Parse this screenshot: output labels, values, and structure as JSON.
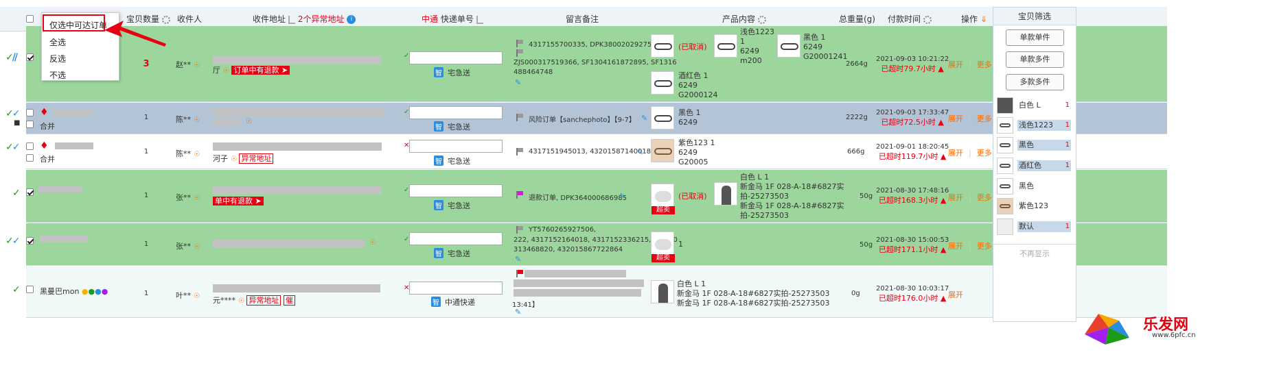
{
  "header": {
    "col_qty": "宝贝数量",
    "col_receiver": "收件人",
    "col_address": "收件地址",
    "col_abnormal": "2个异常地址",
    "col_express": "中通",
    "col_tracking": "快递单号",
    "col_remark": "留言备注",
    "col_product": "产品内容",
    "col_weight": "总重量(g)",
    "col_paytime": "付款时间",
    "col_action": "操作",
    "col_filter": "宝贝筛选"
  },
  "popup": {
    "items": [
      "仅选中可达订单",
      "全选",
      "反选",
      "不选"
    ]
  },
  "rows": [
    {
      "qty": "3",
      "receiver": "赵**",
      "addr_prefix": "厅",
      "addr_badge": "订单中有退款",
      "express_label": "宅急送",
      "remark_lines": [
        "4317155700335, DPK380020292752",
        "ZJS000317519366, SF1304161872895, SF1316",
        "488464748"
      ],
      "products": [
        {
          "status": "(已取消)",
          "lines": []
        },
        {
          "lines": [
            "浅色1223",
            "1",
            "6249",
            "m200"
          ]
        },
        {
          "lines": [
            "黑色 1",
            "6249",
            "G20001241"
          ]
        },
        {
          "lines": [
            "酒红色 1",
            "6249",
            "G2000124"
          ]
        }
      ],
      "weight": "2664g",
      "paytime": "2021-09-03 10:21:22",
      "timeout": "已超时79.7小时",
      "open": "展开",
      "more": "更多"
    },
    {
      "tag": "合并",
      "qty": "1",
      "receiver": "陈**",
      "express_label": "宅急送",
      "remark_lines": [
        "风险订单【sanchephoto】【9-7】"
      ],
      "products": [
        {
          "lines": [
            "黑色 1",
            "6249"
          ]
        }
      ],
      "weight": "2222g",
      "paytime": "2021-09-03 17:33:47",
      "timeout": "已超时72.5小时",
      "open": "展开",
      "more": "更多"
    },
    {
      "tag": "合并",
      "qty": "1",
      "receiver": "陈**",
      "addr_prefix": "河子",
      "addr_badge": "异常地址",
      "express_label": "宅急送",
      "remark_lines": [
        "4317151945013, 432015871400186"
      ],
      "products": [
        {
          "lines": [
            "紫色123 1",
            "6249",
            "G20005"
          ]
        }
      ],
      "weight": "666g",
      "paytime": "2021-09-01 18:20:45",
      "timeout": "已超时119.7小时",
      "open": "展开",
      "more": "更多"
    },
    {
      "qty": "1",
      "receiver": "张**",
      "addr_badge": "单中有退款",
      "express_label": "宅急送",
      "remark_lines": [
        "退款订单, DPK364000686985"
      ],
      "products": [
        {
          "status": "(已取消)",
          "chao": "超卖"
        },
        {
          "lines": [
            "白色 L 1",
            "新金马 1F 028-A-18#6827实",
            "拍-25273503",
            "新金马 1F 028-A-18#6827实",
            "拍-25273503"
          ]
        }
      ],
      "weight": "50g",
      "paytime": "2021-08-30 17:48:16",
      "timeout": "已超时168.3小时",
      "open": "展开",
      "more": "更多"
    },
    {
      "qty": "1",
      "receiver": "张**",
      "express_label": "宅急送",
      "remark_lines": [
        "YT5760265927506,",
        "222, 4317152164018, 4317152336215, ZJS000",
        "313468820, 432015867722864"
      ],
      "products": [
        {
          "lines": [
            "1"
          ],
          "chao": "超卖"
        }
      ],
      "weight": "50g",
      "paytime": "2021-08-30 15:00:53",
      "timeout": "已超时171.1小时",
      "open": "展开",
      "more": "更多"
    },
    {
      "buyer": "黑曼巴mon",
      "qty": "1",
      "receiver": "叶**",
      "addr_prefix": "元****",
      "addr_badge": "异常地址",
      "addr_badge2": "催",
      "express_label": "中通快递",
      "remark_lines": [
        "13:41】"
      ],
      "products": [
        {
          "lines": [
            "白色 L 1",
            "新金马 1F 028-A-18#6827实拍-25273503",
            "新金马 1F 028-A-18#6827实拍-25273503"
          ]
        }
      ],
      "weight": "0g",
      "paytime": "2021-08-30 10:03:17",
      "timeout": "已超时176.0小时",
      "open": "展开",
      "more": ""
    }
  ],
  "sidebar": {
    "buttons": [
      "单款单件",
      "单款多件",
      "多款多件"
    ],
    "items": [
      {
        "label": "白色 L",
        "count": "1",
        "hl": false
      },
      {
        "label": "浅色1223",
        "count": "1",
        "hl": true
      },
      {
        "label": "黑色",
        "count": "1",
        "hl": true
      },
      {
        "label": "酒红色",
        "count": "1",
        "hl": true
      },
      {
        "label": "黑色",
        "count": "",
        "hl": false
      },
      {
        "label": "紫色123",
        "count": "",
        "hl": false
      },
      {
        "label": "默认",
        "count": "1",
        "hl": true
      }
    ],
    "no_show": "不再显示"
  },
  "colors": {
    "green_row": "#9cd69c",
    "blue_row": "#b3c4d6",
    "red": "#e60012",
    "orange": "#ff6a00"
  },
  "logo": {
    "name": "乐发网",
    "url": "www.6pfc.cn"
  }
}
